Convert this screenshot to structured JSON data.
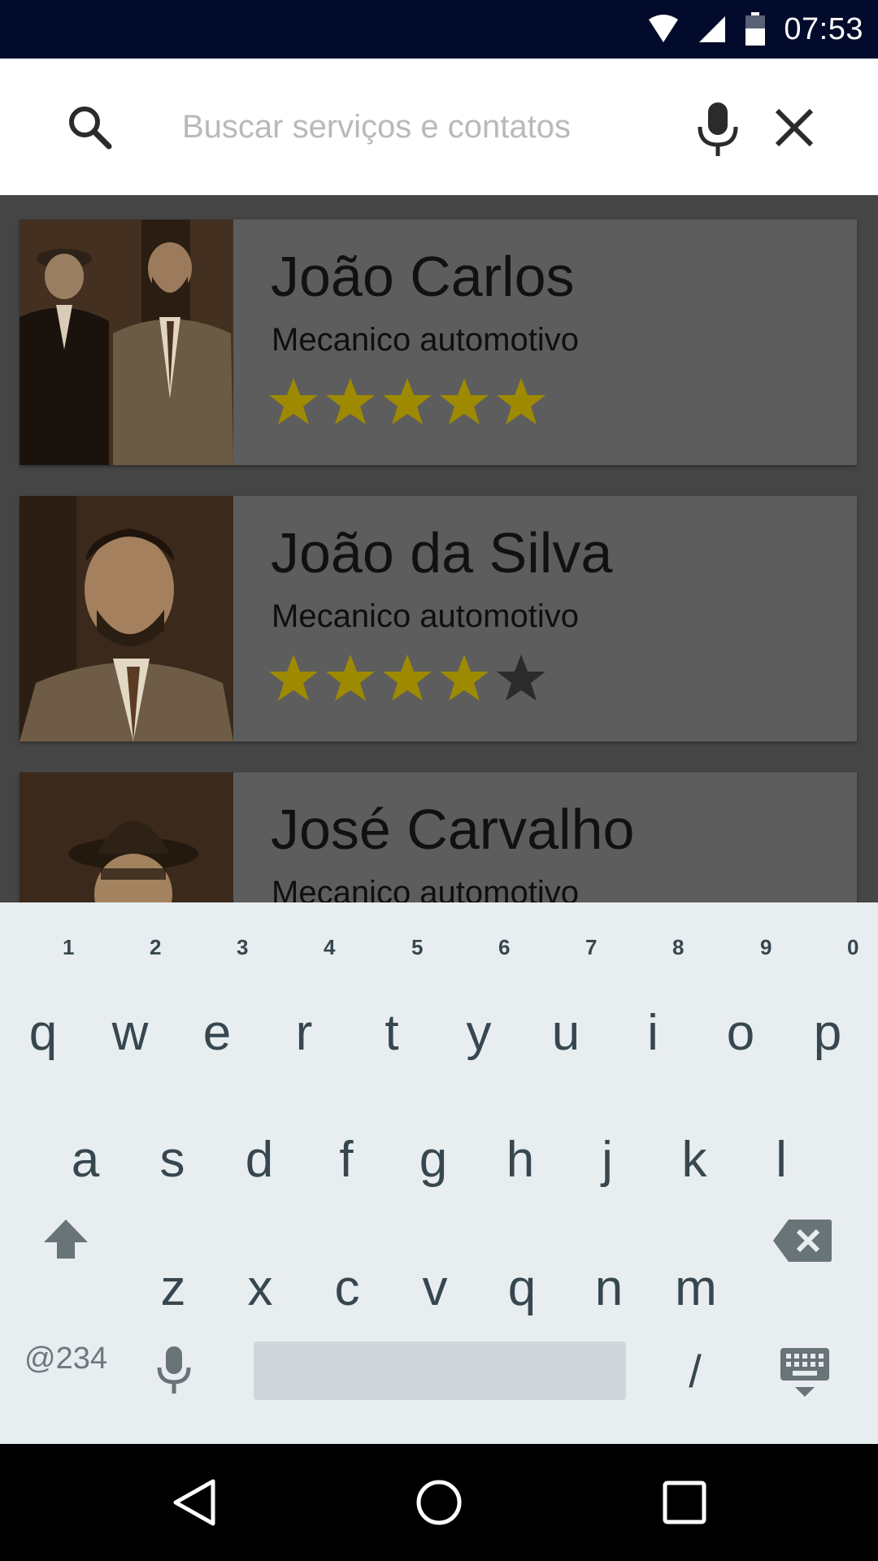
{
  "status_bar": {
    "time": "07:53",
    "icons": [
      "wifi-icon",
      "signal-icon",
      "battery-icon"
    ]
  },
  "search": {
    "placeholder": "Buscar serviços e contatos",
    "value": "",
    "icons": [
      "search-icon",
      "mic-icon",
      "close-icon"
    ]
  },
  "contacts": [
    {
      "name": "João Carlos",
      "service": "Mecanico automotivo",
      "rating": 5,
      "max_rating": 5
    },
    {
      "name": "João da Silva",
      "service": "Mecanico automotivo",
      "rating": 4,
      "max_rating": 5
    },
    {
      "name": "José Carvalho",
      "service": "Mecanico automotivo",
      "rating": null,
      "max_rating": 5
    }
  ],
  "keyboard": {
    "row1": [
      "q",
      "w",
      "e",
      "r",
      "t",
      "y",
      "u",
      "i",
      "o",
      "p"
    ],
    "row1_hints": [
      "1",
      "2",
      "3",
      "4",
      "5",
      "6",
      "7",
      "8",
      "9",
      "0"
    ],
    "row2": [
      "a",
      "s",
      "d",
      "f",
      "g",
      "h",
      "j",
      "k",
      "l"
    ],
    "row3": [
      "z",
      "x",
      "c",
      "v",
      "q",
      "n",
      "m"
    ],
    "symbols_key": "@234",
    "slash_key": "/"
  },
  "colors": {
    "status_bar": "#020b2b",
    "star_filled": "#9e8a00",
    "star_empty": "#2b2b2b",
    "keyboard_bg": "#e8edf0",
    "key_text": "#37474f"
  }
}
